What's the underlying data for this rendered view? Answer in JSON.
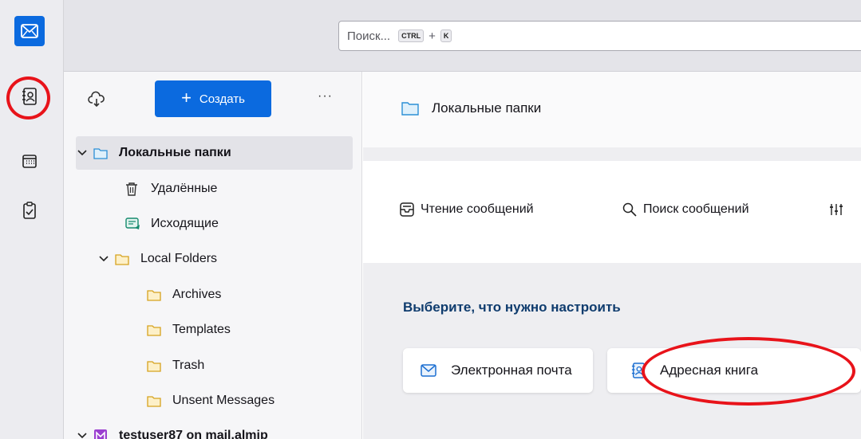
{
  "search": {
    "placeholder": "Поиск...",
    "shortcut_key1": "CTRL",
    "shortcut_plus": "+",
    "shortcut_key2": "K"
  },
  "folderpane": {
    "create_label": "Создать",
    "more_label": "···"
  },
  "tree": [
    {
      "label": "Локальные папки",
      "icon": "folder-icon",
      "bold": true,
      "selected": true
    },
    {
      "label": "Удалённые",
      "icon": "trash-icon"
    },
    {
      "label": "Исходящие",
      "icon": "outbox-icon"
    },
    {
      "label": "Local Folders",
      "icon": "folder-icon"
    },
    {
      "label": "Archives",
      "icon": "folder-icon"
    },
    {
      "label": "Templates",
      "icon": "folder-icon"
    },
    {
      "label": "Trash",
      "icon": "folder-icon"
    },
    {
      "label": "Unsent Messages",
      "icon": "folder-icon"
    },
    {
      "label": "testuser87 on mail.almip",
      "icon": "account-icon",
      "bold": true
    }
  ],
  "main": {
    "title": "Локальные папки",
    "actions": [
      "Чтение сообщений",
      "Поиск сообщений"
    ],
    "section_title": "Выберите, что нужно настроить",
    "setup_cards": [
      "Электронная почта",
      "Адресная книга"
    ]
  },
  "colors": {
    "accent": "#0b6adf",
    "annotation": "#e8131a",
    "folder": "#f0c040"
  }
}
